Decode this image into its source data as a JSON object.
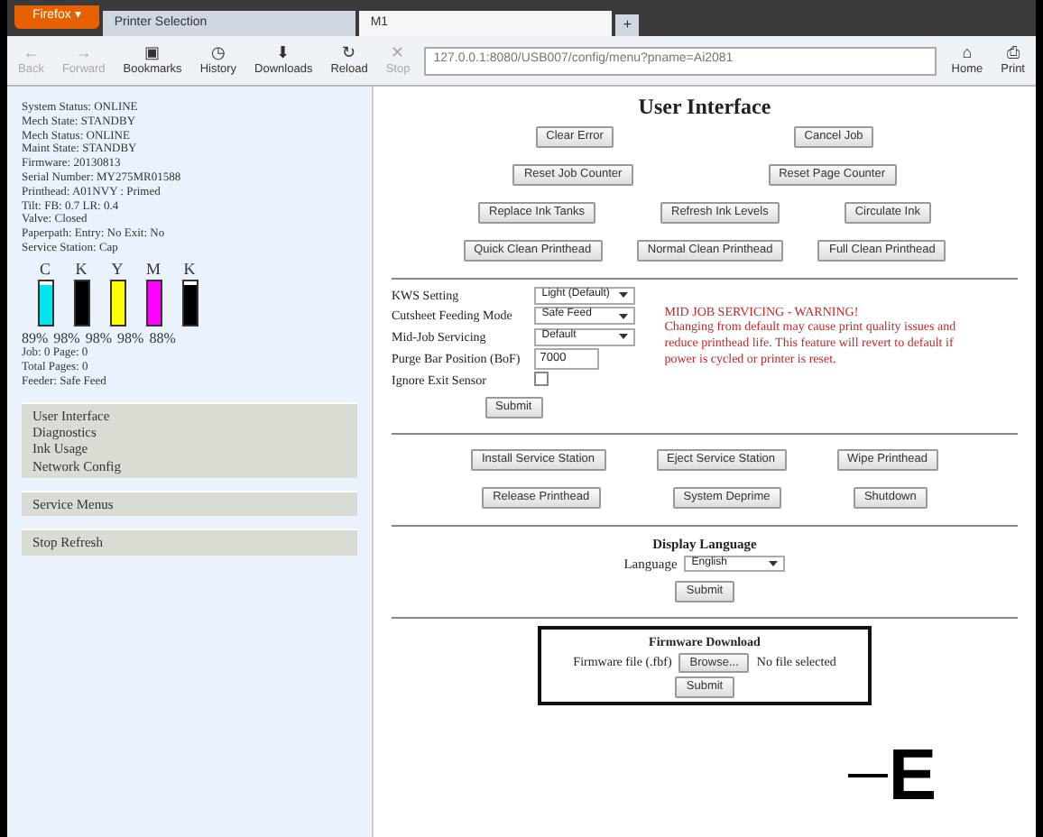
{
  "browser": {
    "app_button": "Firefox ▾",
    "tabs": [
      {
        "title": "Printer Selection",
        "selected": false
      },
      {
        "title": "M1",
        "selected": true
      }
    ],
    "new_tab": "+",
    "toolbar": [
      {
        "label": "Back",
        "icon": "←",
        "disabled": true
      },
      {
        "label": "Forward",
        "icon": "→",
        "disabled": true
      },
      {
        "label": "Bookmarks",
        "icon": "▣",
        "disabled": false
      },
      {
        "label": "History",
        "icon": "◷",
        "disabled": false
      },
      {
        "label": "Downloads",
        "icon": "⬇",
        "disabled": false
      },
      {
        "label": "Reload",
        "icon": "↻",
        "disabled": false
      },
      {
        "label": "Stop",
        "icon": "✕",
        "disabled": true
      }
    ],
    "url": "127.0.0.1:8080/USB007/config/menu?pname=Ai2081",
    "right_buttons": [
      {
        "label": "Home",
        "icon": "⌂"
      },
      {
        "label": "Print",
        "icon": "⎙"
      }
    ]
  },
  "sidebar": {
    "status_lines": [
      "System Status: ONLINE",
      "Mech State: STANDBY",
      "Mech Status: ONLINE",
      "Maint State: STANDBY",
      "Firmware: 20130813",
      "Serial Number: MY275MR01588",
      "Printhead: A01NVY : Primed",
      "Tilt: FB: 0.7 LR: 0.4",
      "Valve: Closed",
      "Paperpath: Entry: No Exit: No",
      "Service Station: Cap"
    ],
    "inks": [
      {
        "letter": "C",
        "color": "#00e5f0",
        "level": 0.89,
        "percent": "89%"
      },
      {
        "letter": "K",
        "color": "#000000",
        "level": 0.98,
        "percent": "98%"
      },
      {
        "letter": "Y",
        "color": "#ffff00",
        "level": 0.98,
        "percent": "98%"
      },
      {
        "letter": "M",
        "color": "#ff00ff",
        "level": 0.98,
        "percent": "98%"
      },
      {
        "letter": "K",
        "color": "#000000",
        "level": 0.88,
        "percent": "88%"
      }
    ],
    "counters": [
      "Job: 0 Page: 0",
      "Total Pages: 0",
      "Feeder: Safe Feed"
    ],
    "menu_groups": [
      [
        "User Interface",
        "Diagnostics",
        "Ink Usage",
        "Network Config"
      ],
      [
        "Service Menus"
      ],
      [
        "Stop Refresh"
      ]
    ]
  },
  "main": {
    "title": "User Interface",
    "button_rows": [
      [
        "Clear Error",
        "Cancel Job"
      ],
      [
        "Reset Job Counter",
        "Reset Page Counter"
      ],
      [
        "Replace Ink Tanks",
        "Refresh Ink Levels",
        "Circulate Ink"
      ],
      [
        "Quick Clean Printhead",
        "Normal Clean Printhead",
        "Full Clean Printhead"
      ]
    ],
    "settings": [
      {
        "kind": "select",
        "label": "KWS Setting",
        "value": "Light (Default)"
      },
      {
        "kind": "select",
        "label": "Cutsheet Feeding Mode",
        "value": "Safe Feed"
      },
      {
        "kind": "select",
        "label": "Mid-Job Servicing",
        "value": "Default"
      },
      {
        "kind": "text",
        "label": "Purge Bar Position (BoF)",
        "value": "7000"
      },
      {
        "kind": "checkbox",
        "label": "Ignore Exit Sensor",
        "checked": false
      }
    ],
    "settings_submit": "Submit",
    "warning_title": "MID JOB SERVICING - WARNING!",
    "warning_text": "Changing from default may cause print quality issues and reduce printhead life. This feature will revert to default if power is cycled or printer is reset.",
    "service_rows": [
      [
        "Install Service Station",
        "Eject Service Station",
        "Wipe Printhead"
      ],
      [
        "Release Printhead",
        "System Deprime",
        "Shutdown"
      ]
    ],
    "language": {
      "heading": "Display Language",
      "label": "Language",
      "value": "English",
      "submit": "Submit"
    },
    "firmware": {
      "heading": "Firmware Download",
      "label": "Firmware file (.fbf)",
      "browse": "Browse...",
      "file": "No file selected",
      "submit": "Submit"
    },
    "callout": "E"
  }
}
